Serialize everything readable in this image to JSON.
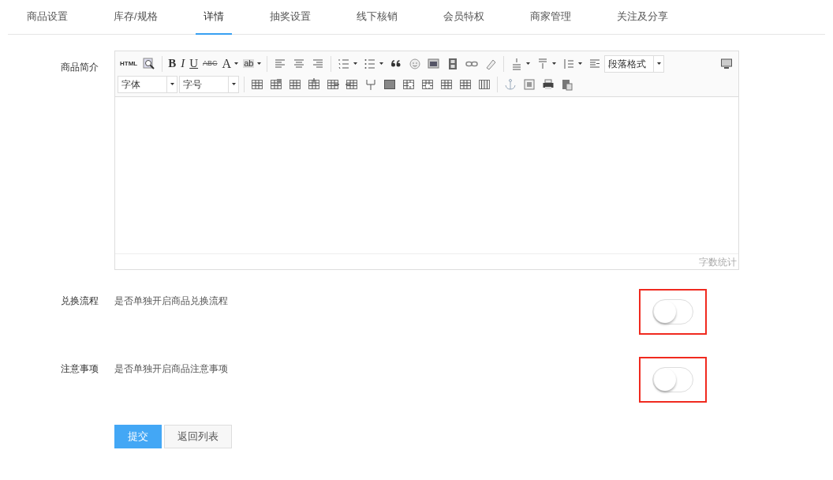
{
  "tabs": [
    {
      "label": "商品设置",
      "selected": false
    },
    {
      "label": "库存/规格",
      "selected": false
    },
    {
      "label": "详情",
      "selected": true
    },
    {
      "label": "抽奖设置",
      "selected": false
    },
    {
      "label": "线下核销",
      "selected": false
    },
    {
      "label": "会员特权",
      "selected": false
    },
    {
      "label": "商家管理",
      "selected": false
    },
    {
      "label": "关注及分享",
      "selected": false
    }
  ],
  "editor": {
    "label": "商品简介",
    "word_count": "字数统计",
    "toolbar_row_1": [
      {
        "kind": "text",
        "label": "HTML"
      },
      {
        "kind": "icon"
      },
      {
        "kind": "sep"
      },
      {
        "kind": "text",
        "label": "B"
      },
      {
        "kind": "text",
        "label": "I"
      },
      {
        "kind": "text",
        "label": "U"
      },
      {
        "kind": "text",
        "label": "ABC"
      },
      {
        "kind": "text",
        "label": "A"
      },
      {
        "kind": "text",
        "label": "ab"
      },
      {
        "kind": "sep"
      },
      {
        "kind": "icon"
      },
      {
        "kind": "icon"
      },
      {
        "kind": "icon"
      },
      {
        "kind": "sep"
      },
      {
        "kind": "icon"
      },
      {
        "kind": "icon"
      },
      {
        "kind": "icon"
      },
      {
        "kind": "icon"
      },
      {
        "kind": "icon"
      },
      {
        "kind": "icon"
      },
      {
        "kind": "icon"
      },
      {
        "kind": "icon"
      },
      {
        "kind": "sep"
      },
      {
        "kind": "icon"
      },
      {
        "kind": "icon"
      },
      {
        "kind": "icon"
      },
      {
        "kind": "icon"
      },
      {
        "kind": "select",
        "label": "段落格式"
      },
      {
        "kind": "spacer"
      },
      {
        "kind": "icon"
      }
    ],
    "toolbar_row_2": [
      {
        "kind": "select",
        "label": "字体"
      },
      {
        "kind": "select",
        "label": "字号"
      },
      {
        "kind": "sep"
      },
      {
        "kind": "icon"
      },
      {
        "kind": "icon"
      },
      {
        "kind": "icon"
      },
      {
        "kind": "icon"
      },
      {
        "kind": "icon"
      },
      {
        "kind": "icon"
      },
      {
        "kind": "icon"
      },
      {
        "kind": "icon"
      },
      {
        "kind": "icon"
      },
      {
        "kind": "icon"
      },
      {
        "kind": "icon"
      },
      {
        "kind": "icon"
      },
      {
        "kind": "icon"
      },
      {
        "kind": "sep"
      },
      {
        "kind": "icon"
      },
      {
        "kind": "icon"
      },
      {
        "kind": "icon"
      },
      {
        "kind": "icon"
      }
    ]
  },
  "settings": [
    {
      "label": "兑换流程",
      "description": "是否单独开启商品兑换流程",
      "on": false,
      "highlighted": true
    },
    {
      "label": "注意事项",
      "description": "是否单独开启商品注意事项",
      "on": false,
      "highlighted": true
    }
  ],
  "buttons": [
    {
      "label": "提交",
      "kind": "primary"
    },
    {
      "label": "返回列表",
      "kind": "default"
    }
  ]
}
